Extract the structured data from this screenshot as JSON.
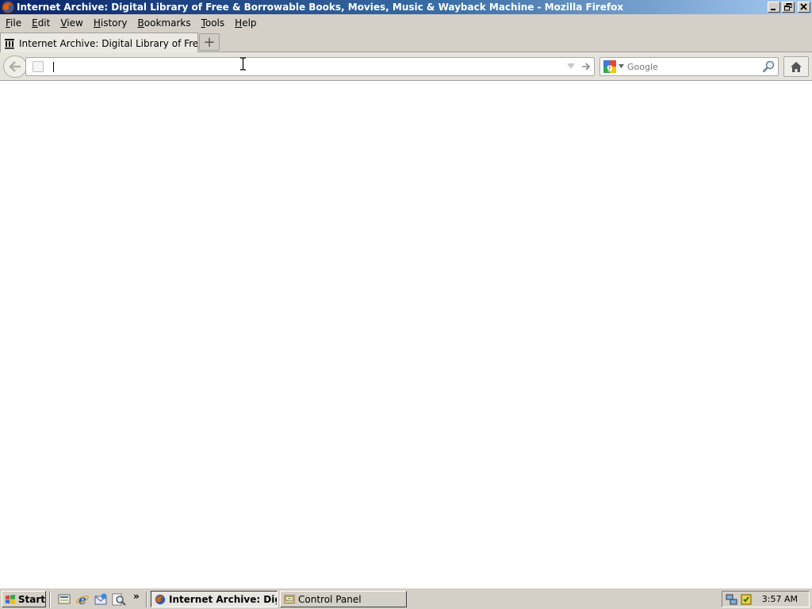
{
  "window": {
    "title": "Internet Archive: Digital Library of Free & Borrowable Books, Movies, Music & Wayback Machine - Mozilla Firefox",
    "app_icon": "firefox-icon",
    "controls": [
      "minimize-icon",
      "restore-icon",
      "close-icon"
    ]
  },
  "menubar": {
    "items": [
      {
        "key": "F",
        "rest": "ile"
      },
      {
        "key": "E",
        "rest": "dit"
      },
      {
        "key": "V",
        "rest": "iew"
      },
      {
        "key": "H",
        "rest": "istory"
      },
      {
        "key": "B",
        "rest": "ookmarks"
      },
      {
        "key": "T",
        "rest": "ools"
      },
      {
        "key": "H",
        "rest": "elp"
      }
    ]
  },
  "tabs": [
    {
      "label": "Internet Archive: Digital Library of Free & Bo...",
      "icon": "internet-archive-icon",
      "active": true
    }
  ],
  "new_tab_label": "+",
  "navbar": {
    "url_value": "",
    "search_placeholder": "Google",
    "search_engine_icon": "google-icon"
  },
  "taskbar": {
    "start_label": "Start",
    "tasks": [
      {
        "label": "Internet Archive: Digit...",
        "icon": "firefox-icon",
        "active": true
      },
      {
        "label": "Control Panel",
        "icon": "control-panel-icon",
        "active": false
      }
    ],
    "quick_launch_more": "»",
    "clock": "3:57 AM"
  },
  "colors": {
    "titlebar_start": "#0a246a",
    "titlebar_end": "#a6caf0",
    "chrome": "#d4d0c8"
  }
}
